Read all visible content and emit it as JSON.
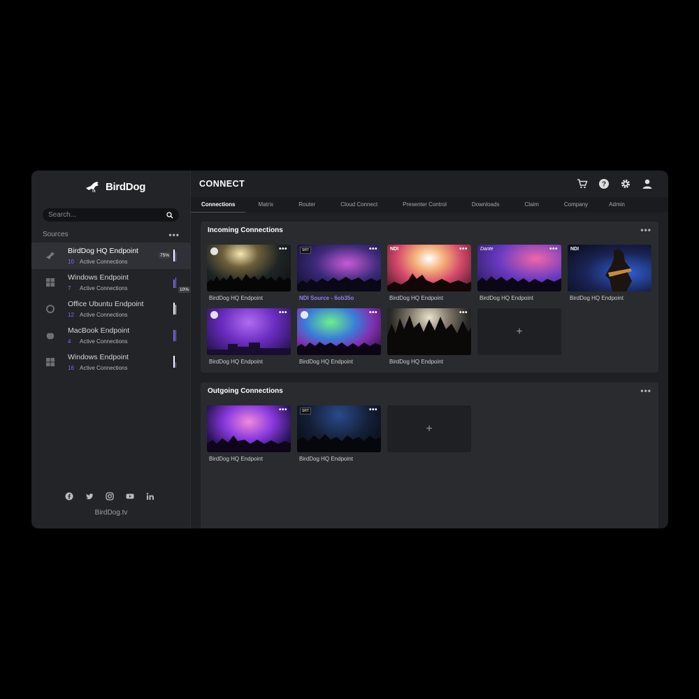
{
  "sidebar": {
    "logo_text": "BirdDog",
    "search_placeholder": "Search...",
    "sources_label": "Sources",
    "sources": [
      {
        "name": "BirdDog HQ Endpoint",
        "count": "10",
        "sub": "Active Connections",
        "icon": "birddog-icon",
        "level": 0.75
      },
      {
        "name": "Windows Endpoint",
        "count": "7",
        "sub": "Active Connections",
        "icon": "windows-icon",
        "level": 0.6
      },
      {
        "name": "Office Ubuntu Endpoint",
        "count": "12",
        "sub": "Active Connections",
        "icon": "ubuntu-icon",
        "level": 0.8
      },
      {
        "name": "MacBook Endpoint",
        "count": "4",
        "sub": "Active Connections",
        "icon": "apple-icon",
        "level": 0.7
      },
      {
        "name": "Windows Endpoint",
        "count": "16",
        "sub": "Active Connections",
        "icon": "windows-icon",
        "level": 0.1
      }
    ],
    "source_pct_1": "75%",
    "source_pct_5": "10%",
    "site": "BirdDog.tv",
    "socials": [
      "facebook-icon",
      "twitter-icon",
      "instagram-icon",
      "youtube-icon",
      "linkedin-icon"
    ]
  },
  "header": {
    "brand": "CONNECT",
    "icons": [
      "cart-icon",
      "help-icon",
      "settings-icon",
      "user-icon"
    ]
  },
  "tabs": [
    "Connections",
    "Matrix",
    "Router",
    "Cloud Connect",
    "Presenter Control",
    "Downloads",
    "Claim",
    "Company",
    "Admin"
  ],
  "incoming": {
    "title": "Incoming Connections",
    "tiles": [
      {
        "caption": "BirdDog HQ Endpoint",
        "badge": "link"
      },
      {
        "caption": "NDI Source - 6ob35o",
        "badge": "SRT"
      },
      {
        "caption": "BirdDog HQ Endpoint",
        "badge": "NDI"
      },
      {
        "caption": "BirdDog HQ Endpoint",
        "badge": "Dante"
      },
      {
        "caption": "BirdDog HQ Endpoint",
        "badge": "NDI"
      },
      {
        "caption": "BirdDog HQ Endpoint",
        "badge": "link"
      },
      {
        "caption": "BirdDog HQ Endpoint",
        "badge": "link"
      },
      {
        "caption": "BirdDog HQ Endpoint",
        "badge": ""
      }
    ],
    "add_label": "+"
  },
  "outgoing": {
    "title": "Outgoing Connections",
    "tiles": [
      {
        "caption": "BirdDog HQ Endpoint",
        "badge": ""
      },
      {
        "caption": "BirdDog HQ Endpoint",
        "badge": "SRT"
      }
    ],
    "add_label": "+"
  },
  "colors": {
    "accent": "#7d6cf3",
    "background": "#1f2023",
    "panel": "#2a2b2f"
  }
}
